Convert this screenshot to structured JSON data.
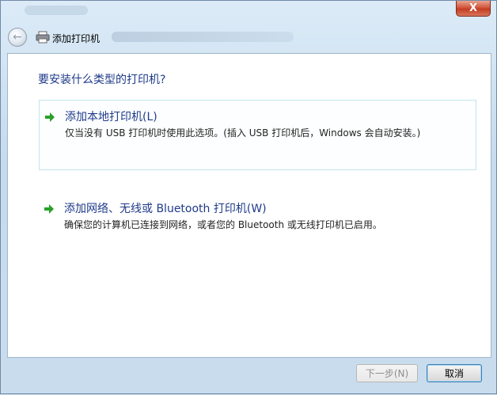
{
  "window": {
    "close_symbol": "X"
  },
  "nav": {
    "back_icon": "back-arrow-icon",
    "title": "添加打印机"
  },
  "main": {
    "question": "要安装什么类型的打印机?",
    "options": [
      {
        "title": "添加本地打印机(L)",
        "description": "仅当没有 USB 打印机时使用此选项。(插入 USB 打印机后，Windows 会自动安装。)"
      },
      {
        "title": "添加网络、无线或 Bluetooth 打印机(W)",
        "description": "确保您的计算机已连接到网络，或者您的 Bluetooth 或无线打印机已启用。"
      }
    ],
    "arrow_color": "#2aa02a",
    "selected_border_color": "#bfe6ee"
  },
  "footer": {
    "next_label": "下一步(N)",
    "cancel_label": "取消"
  }
}
